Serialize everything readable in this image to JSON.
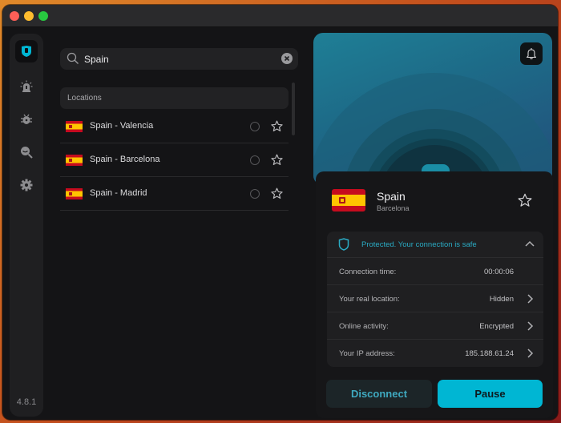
{
  "app": {
    "version": "4.8.1",
    "accent_color": "#00b6d3"
  },
  "sidebar": {
    "items": [
      {
        "icon": "vpn-shield-icon",
        "active": true
      },
      {
        "icon": "alarm-icon",
        "active": false
      },
      {
        "icon": "bug-icon",
        "active": false
      },
      {
        "icon": "search-zoom-icon",
        "active": false
      },
      {
        "icon": "gear-icon",
        "active": false
      }
    ]
  },
  "search": {
    "value": "Spain",
    "icon": "search-icon",
    "clear_icon": "clear-icon"
  },
  "locations": {
    "header": "Locations",
    "items": [
      {
        "name": "Spain - Valencia",
        "flag": "es"
      },
      {
        "name": "Spain - Barcelona",
        "flag": "es"
      },
      {
        "name": "Spain - Madrid",
        "flag": "es"
      }
    ]
  },
  "connection": {
    "country": "Spain",
    "city": "Barcelona",
    "status_text": "Protected. Your connection is safe",
    "rows": [
      {
        "label": "Connection time:",
        "value": "00:00:06",
        "has_chevron": false
      },
      {
        "label": "Your real location:",
        "value": "Hidden",
        "has_chevron": true
      },
      {
        "label": "Online activity:",
        "value": "Encrypted",
        "has_chevron": true
      },
      {
        "label": "Your IP address:",
        "value": "185.188.61.24",
        "has_chevron": true
      }
    ],
    "disconnect_label": "Disconnect",
    "pause_label": "Pause"
  }
}
